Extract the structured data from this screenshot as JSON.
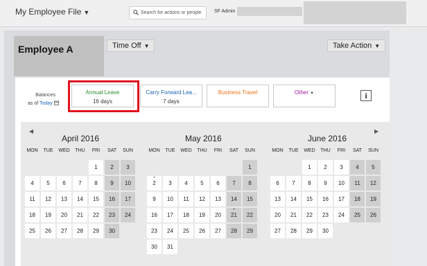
{
  "header": {
    "app_title": "My Employee File",
    "search_placeholder": "Search for actions or people",
    "user": "SF Admin"
  },
  "employee": {
    "name": "Employee A",
    "time_off_label": "Time Off",
    "take_action_label": "Take Action"
  },
  "balances": {
    "label": "Balances",
    "as_of_prefix": "as of",
    "as_of_link": "Today",
    "tiles": [
      {
        "label": "Annual Leave",
        "value": "16 days",
        "color": "#2e8b2e"
      },
      {
        "label": "Carry Forward Lea...",
        "value": "7 days",
        "color": "#1a64b4"
      },
      {
        "label": "Business Travel",
        "value": "",
        "color": "#e8701a"
      },
      {
        "label": "Other",
        "value": "",
        "color": "#a01aa0"
      }
    ],
    "info_icon": "info-icon"
  },
  "calendar": {
    "weekdays": [
      "MON",
      "TUE",
      "WED",
      "THU",
      "FRI",
      "SAT",
      "SUN"
    ],
    "months": [
      {
        "title": "April 2016",
        "offset": 4,
        "days": 30,
        "starred": []
      },
      {
        "title": "May 2016",
        "offset": 6,
        "days": 31,
        "starred": [
          2,
          21
        ]
      },
      {
        "title": "June 2016",
        "offset": 2,
        "days": 30,
        "starred": []
      }
    ]
  }
}
